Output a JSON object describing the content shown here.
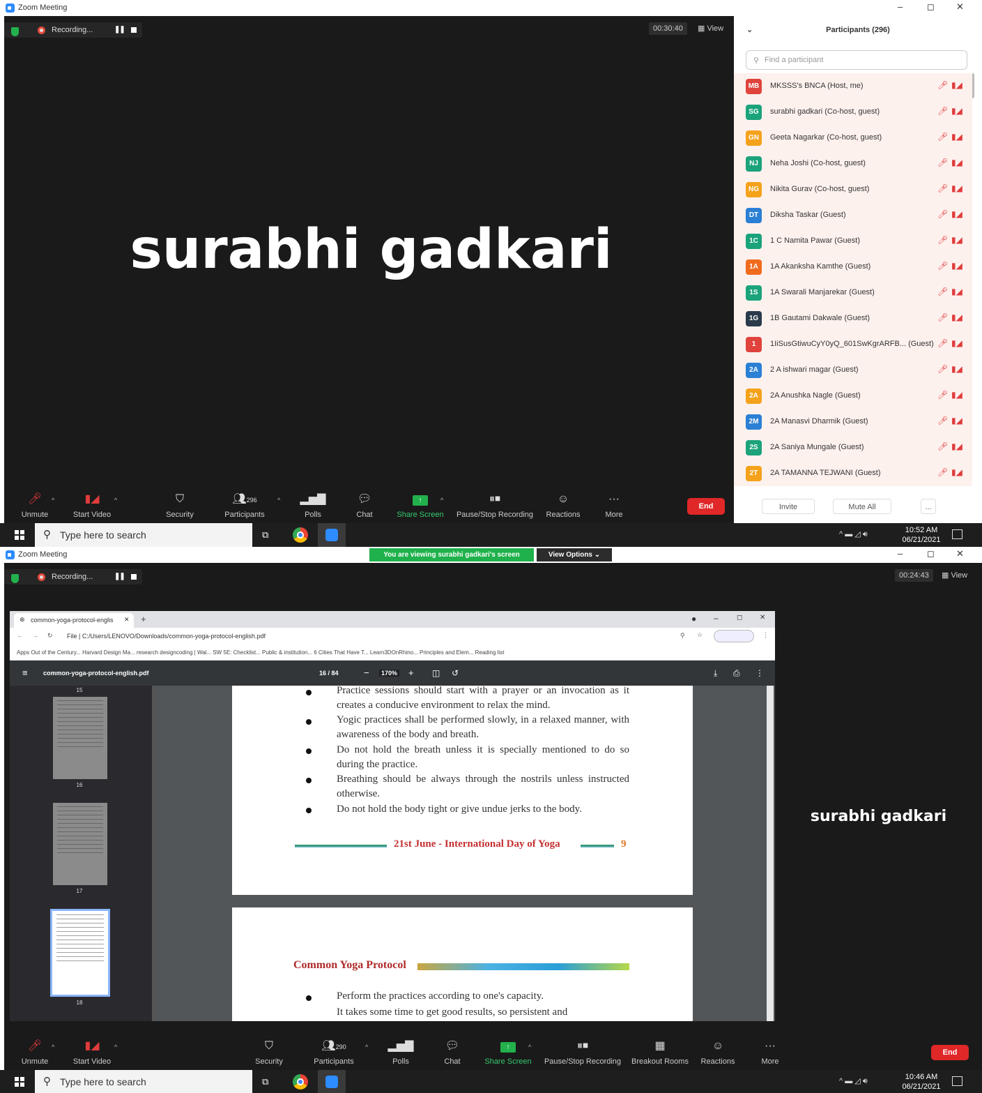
{
  "shot1": {
    "window_title": "Zoom Meeting",
    "recording_label": "Recording...",
    "pause_glyph": "❚❚",
    "timer": "00:30:40",
    "view_label": "View",
    "speaker_name": "surabhi gadkari",
    "toolbar": {
      "unmute": "Unmute",
      "start_video": "Start Video",
      "security": "Security",
      "participants": "Participants",
      "participants_count": "296",
      "polls": "Polls",
      "chat": "Chat",
      "share_screen": "Share Screen",
      "pause_stop_recording": "Pause/Stop Recording",
      "reactions": "Reactions",
      "more": "More",
      "end": "End"
    },
    "participants_panel": {
      "title": "Participants (296)",
      "search_placeholder": "Find a participant",
      "invite": "Invite",
      "mute_all": "Mute All",
      "more": "...",
      "items": [
        {
          "initials": "MB",
          "name": "MKSSS's BNCA (Host, me)",
          "color": "#e0433c"
        },
        {
          "initials": "SG",
          "name": "surabhi gadkari (Co-host, guest)",
          "color": "#1ba37b"
        },
        {
          "initials": "GN",
          "name": "Geeta Nagarkar (Co-host, guest)",
          "color": "#f4a21b"
        },
        {
          "initials": "NJ",
          "name": "Neha Joshi (Co-host, guest)",
          "color": "#1ba37b"
        },
        {
          "initials": "NG",
          "name": "Nikita Gurav (Co-host, guest)",
          "color": "#f4a21b"
        },
        {
          "initials": "DT",
          "name": "Diksha Taskar (Guest)",
          "color": "#2b7fd4"
        },
        {
          "initials": "1C",
          "name": "1 C Namita Pawar (Guest)",
          "color": "#1ba37b"
        },
        {
          "initials": "1A",
          "name": "1A Akanksha Kamthe (Guest)",
          "color": "#f06b1e"
        },
        {
          "initials": "1S",
          "name": "1A Swarali Manjarekar (Guest)",
          "color": "#1ba37b"
        },
        {
          "initials": "1G",
          "name": "1B Gautami Dakwale (Guest)",
          "color": "#2a3a4a"
        },
        {
          "initials": "1",
          "name": "1IiSusGtiwuCyY0yQ_601SwKgrARFB... (Guest)",
          "color": "#e0433c"
        },
        {
          "initials": "2A",
          "name": "2 A ishwari magar (Guest)",
          "color": "#2b7fd4"
        },
        {
          "initials": "2A",
          "name": "2A Anushka Nagle (Guest)",
          "color": "#f4a21b"
        },
        {
          "initials": "2M",
          "name": "2A Manasvi Dharmik (Guest)",
          "color": "#2b7fd4"
        },
        {
          "initials": "2S",
          "name": "2A Saniya Mungale (Guest)",
          "color": "#1ba37b"
        },
        {
          "initials": "2T",
          "name": "2A TAMANNA TEJWANI (Guest)",
          "color": "#f4a21b"
        }
      ]
    },
    "taskbar": {
      "search_placeholder": "Type here to search",
      "time": "10:52 AM",
      "date": "06/21/2021"
    }
  },
  "shot2": {
    "window_title": "Zoom Meeting",
    "share_banner": "You are viewing surabhi gadkari's screen",
    "view_options": "View Options ⌄",
    "recording_label": "Recording...",
    "pause_glyph": "❚❚",
    "timer": "00:24:43",
    "view_label": "View",
    "speaker_name": "surabhi gadkari",
    "browser": {
      "tab_title": "common-yoga-protocol-englis",
      "address": "File  |  C:/Users/LENOVO/Downloads/common-yoga-protocol-english.pdf",
      "bookmarks": "Apps    Out of the Century...    Harvard Design Ma...    research    designcoding | Wal...    SW 5E: Checklist...    Public & institution...    6 Cities That Have T...    Learn3DOnRhino...    Principles and Elem...    Reading list",
      "pdf_name": "common-yoga-protocol-english.pdf",
      "page_indicator": "16 / 84",
      "zoom": "170%",
      "thumb_labels": [
        "15",
        "16",
        "17",
        "18"
      ],
      "lines_page1": [
        "Practice sessions should start with a prayer or an invocation as it creates a conducive environment to relax the mind.",
        "Yogic practices shall be performed slowly, in a relaxed manner, with awareness of the body and breath.",
        "Do not hold the breath unless it is specially mentioned to do so during the practice.",
        "Breathing should be always through the nostrils unless instructed otherwise.",
        "Do not hold the body tight or give undue jerks to the body."
      ],
      "footer_text": "21st June - International Day of Yoga",
      "footer_page": "9",
      "page2_heading": "Common Yoga Protocol",
      "page2_line": "Perform the practices according to one's capacity.",
      "page2_line_cut": "It takes some time to get good results, so persistent and"
    },
    "toolbar": {
      "unmute": "Unmute",
      "start_video": "Start Video",
      "security": "Security",
      "participants": "Participants",
      "participants_count": "290",
      "polls": "Polls",
      "chat": "Chat",
      "share_screen": "Share Screen",
      "pause_stop_recording": "Pause/Stop Recording",
      "breakout_rooms": "Breakout Rooms",
      "reactions": "Reactions",
      "more": "More",
      "end": "End"
    },
    "taskbar": {
      "search_placeholder": "Type here to search",
      "time": "10:46 AM",
      "date": "06/21/2021"
    }
  }
}
